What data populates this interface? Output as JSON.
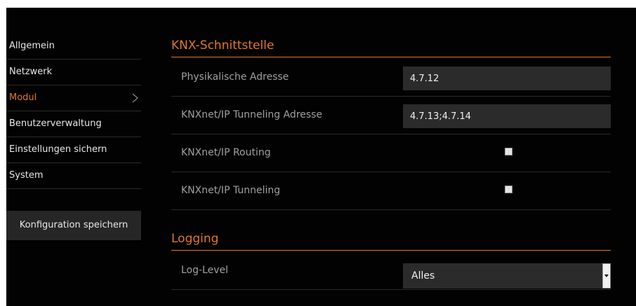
{
  "sidebar": {
    "items": [
      {
        "label": "Allgemein"
      },
      {
        "label": "Netzwerk"
      },
      {
        "label": "Modul"
      },
      {
        "label": "Benutzerverwaltung"
      },
      {
        "label": "Einstellungen sichern"
      },
      {
        "label": "System"
      }
    ],
    "active_item": "Modul",
    "save_button_label": "Konfiguration speichern"
  },
  "knx": {
    "title": "KNX-Schnittstelle",
    "physical_address": {
      "label": "Physikalische Adresse",
      "value": "4.7.12"
    },
    "tunneling_address": {
      "label": "KNXnet/IP Tunneling Adresse",
      "value": "4.7.13;4.7.14"
    },
    "routing": {
      "label": "KNXnet/IP Routing",
      "checked": false
    },
    "tunneling": {
      "label": "KNXnet/IP Tunneling",
      "checked": false
    }
  },
  "logging": {
    "title": "Logging",
    "log_level": {
      "label": "Log-Level",
      "value": "Alles"
    }
  },
  "colors": {
    "accent": "#e0782a",
    "background": "#020202",
    "field_background": "#2b2b2b"
  }
}
